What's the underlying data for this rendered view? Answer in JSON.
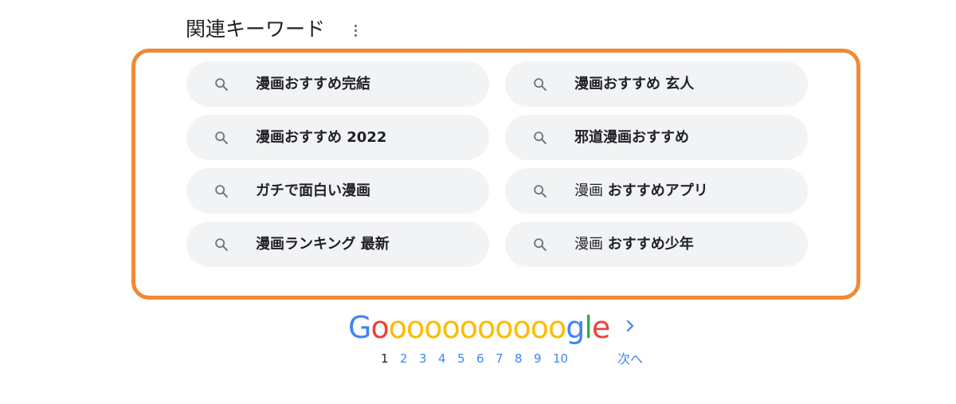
{
  "section": {
    "title": "関連キーワード"
  },
  "colors": {
    "highlight_border": "#f08a36",
    "chip_bg": "#f1f3f4",
    "link": "#4285f4"
  },
  "related": [
    {
      "icon": "search-icon",
      "normal": "",
      "bold": "漫画おすすめ完結"
    },
    {
      "icon": "search-icon",
      "normal": "",
      "bold": "漫画おすすめ 玄人"
    },
    {
      "icon": "search-icon",
      "normal": "",
      "bold": "漫画おすすめ 2022"
    },
    {
      "icon": "search-icon",
      "normal": "",
      "bold": "邪道漫画おすすめ"
    },
    {
      "icon": "search-icon",
      "normal": "",
      "bold": "ガチで面白い漫画"
    },
    {
      "icon": "search-icon",
      "normal": "漫画 ",
      "bold": "おすすめアプリ"
    },
    {
      "icon": "search-icon",
      "normal": "",
      "bold": "漫画ランキング 最新"
    },
    {
      "icon": "search-icon",
      "normal": "漫画 ",
      "bold": "おすすめ少年"
    }
  ],
  "pagination": {
    "logo_letters": [
      {
        "ch": "G",
        "color": "#4285f4"
      },
      {
        "ch": "o",
        "color": "#ea4335"
      },
      {
        "ch": "o",
        "color": "#fbbc05"
      },
      {
        "ch": "o",
        "color": "#fbbc05"
      },
      {
        "ch": "o",
        "color": "#fbbc05"
      },
      {
        "ch": "o",
        "color": "#fbbc05"
      },
      {
        "ch": "o",
        "color": "#fbbc05"
      },
      {
        "ch": "o",
        "color": "#fbbc05"
      },
      {
        "ch": "o",
        "color": "#fbbc05"
      },
      {
        "ch": "o",
        "color": "#fbbc05"
      },
      {
        "ch": "o",
        "color": "#fbbc05"
      },
      {
        "ch": "o",
        "color": "#fbbc05"
      },
      {
        "ch": "g",
        "color": "#4285f4"
      },
      {
        "ch": "l",
        "color": "#34a853"
      },
      {
        "ch": "e",
        "color": "#ea4335"
      }
    ],
    "pages": [
      "1",
      "2",
      "3",
      "4",
      "5",
      "6",
      "7",
      "8",
      "9",
      "10"
    ],
    "current_page": "1",
    "next_label": "次へ",
    "next_icon": "chevron-right-icon"
  }
}
